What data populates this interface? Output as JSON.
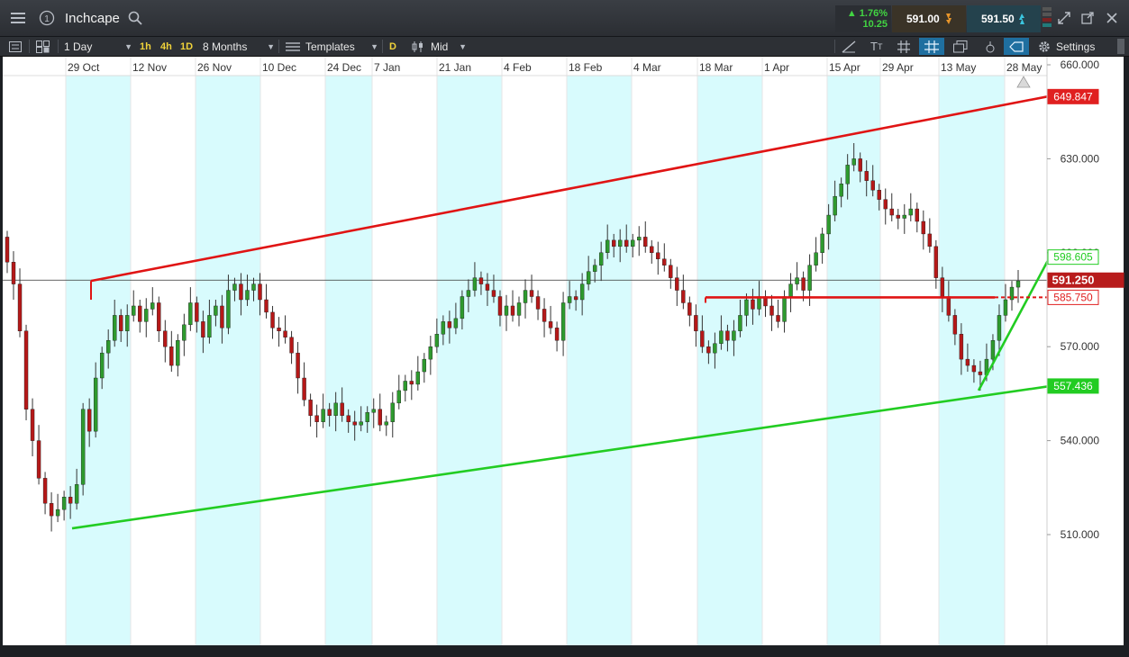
{
  "window": {
    "title": "Inchcape",
    "change_pct": "▲ 1.76%",
    "change_abs": "10.25",
    "sell_price": "591.00",
    "buy_price": "591.50",
    "sell_color": "#3a3327",
    "buy_color": "#24424d",
    "up_color": "#42d442"
  },
  "toolbar": {
    "interval": "1 Day",
    "quick_1h": "1h",
    "quick_4h": "4h",
    "quick_1d": "1D",
    "range": "8 Months",
    "templates": "Templates",
    "price_type_badge": "D",
    "price_mode": "Mid",
    "settings": "Settings",
    "text_tool": "T"
  },
  "chart_data": {
    "type": "candlestick",
    "x_ticks": [
      "29 Oct",
      "12 Nov",
      "26 Nov",
      "10 Dec",
      "24 Dec",
      "7 Jan",
      "21 Jan",
      "4 Feb",
      "18 Feb",
      "4 Mar",
      "18 Mar",
      "1 Apr",
      "15 Apr",
      "29 Apr",
      "13 May",
      "28 May"
    ],
    "y_ticks": [
      "660.000",
      "630.000",
      "600.000",
      "570.000",
      "540.000",
      "510.000"
    ],
    "y_range": [
      480,
      660
    ],
    "last_price": 591.25,
    "price_labels": {
      "upper_channel": "649.847",
      "resistance_600": "598.605",
      "last": "591.250",
      "horizontal_level": "585.750",
      "lower_channel": "557.436"
    },
    "colors": {
      "up": "#2e9a2e",
      "down": "#b51818",
      "red_line": "#e01414",
      "green_line": "#22cc22",
      "shade": "#d8fbfd"
    },
    "trendlines": [
      {
        "name": "upper-channel",
        "from": [
          "29 Oct",
          591
        ],
        "to": [
          "28 May",
          650
        ]
      },
      {
        "name": "lower-channel",
        "from": [
          "29 Oct",
          512
        ],
        "to": [
          "28 May",
          557
        ]
      },
      {
        "name": "horizontal-resistance",
        "from": [
          "18 Mar",
          586
        ],
        "to": [
          "28 May",
          586
        ]
      },
      {
        "name": "short-term-uptrend",
        "from": [
          "13 May",
          556
        ],
        "to": [
          "28 May",
          599
        ]
      }
    ],
    "closes": [
      597,
      590,
      575,
      550,
      540,
      528,
      520,
      516,
      518,
      522,
      520,
      526,
      550,
      543,
      560,
      568,
      572,
      580,
      575,
      580,
      583,
      578,
      582,
      584,
      575,
      570,
      564,
      572,
      577,
      584,
      578,
      573,
      580,
      583,
      576,
      588,
      590,
      585,
      588,
      590,
      585,
      581,
      576,
      575,
      573,
      568,
      560,
      553,
      548,
      546,
      550,
      548,
      552,
      548,
      546,
      545,
      546,
      549,
      550,
      545,
      546,
      552,
      556,
      559,
      558,
      562,
      566,
      570,
      574,
      578,
      576,
      579,
      586,
      588,
      592,
      590,
      588,
      586,
      580,
      583,
      580,
      584,
      588,
      586,
      582,
      578,
      576,
      572,
      584,
      586,
      585,
      590,
      594,
      596,
      600,
      604,
      602,
      604,
      602,
      604,
      605,
      602,
      600,
      598,
      596,
      592,
      588,
      584,
      580,
      575,
      570,
      568,
      571,
      575,
      572,
      575,
      580,
      585,
      582,
      586,
      583,
      580,
      578,
      586,
      590,
      592,
      588,
      596,
      600,
      606,
      612,
      618,
      622,
      628,
      630,
      626,
      623,
      620,
      617,
      614,
      612,
      611,
      612,
      614,
      610,
      606,
      602,
      592,
      586,
      580,
      574,
      566,
      564,
      562,
      561,
      566,
      572,
      580,
      585,
      589,
      591
    ]
  }
}
